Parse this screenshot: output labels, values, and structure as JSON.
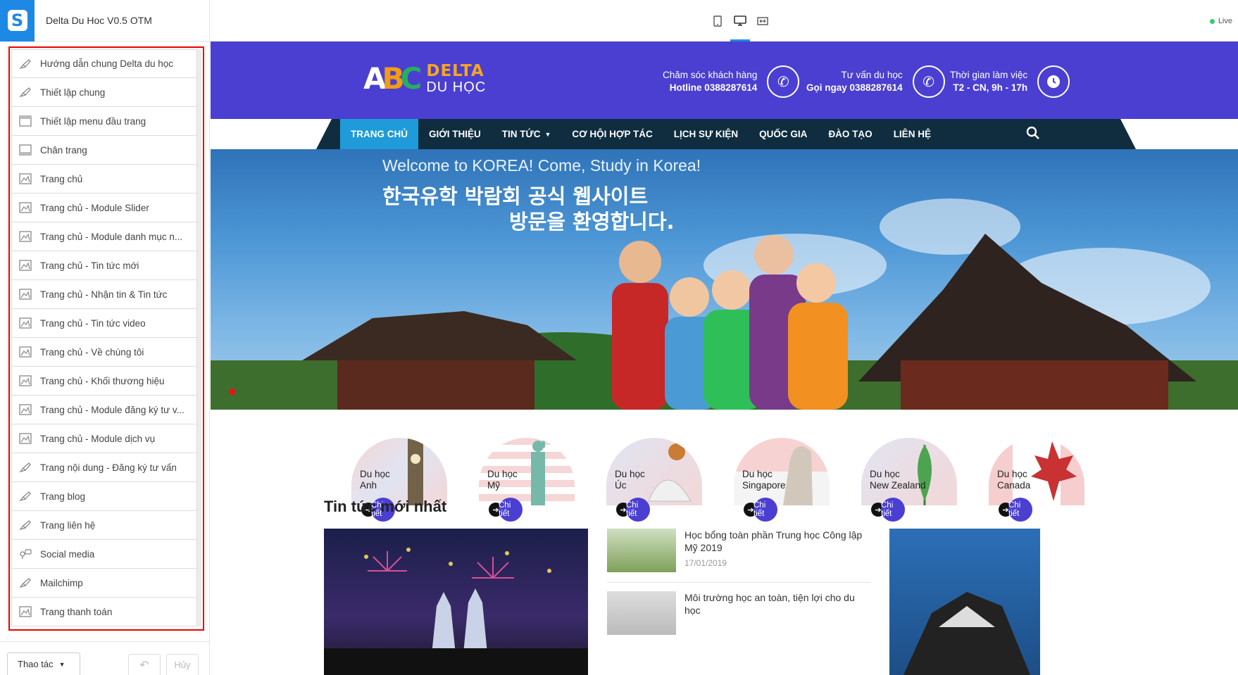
{
  "app": {
    "title": "Delta Du Hoc V0.5 OTM",
    "logo_letter": "S"
  },
  "sidebar": {
    "items": [
      {
        "label": "Hướng dẫn chung Delta du học",
        "icon": "brush-icon"
      },
      {
        "label": "Thiết lập chung",
        "icon": "brush-icon"
      },
      {
        "label": "Thiết lập menu đầu trang",
        "icon": "header-layout-icon"
      },
      {
        "label": "Chân trang",
        "icon": "footer-layout-icon"
      },
      {
        "label": "Trang chủ",
        "icon": "homepage-icon"
      },
      {
        "label": "Trang chủ - Module Slider",
        "icon": "homepage-icon"
      },
      {
        "label": "Trang chủ - Module danh mục n...",
        "icon": "homepage-icon"
      },
      {
        "label": "Trang chủ - Tin tức mới",
        "icon": "homepage-icon"
      },
      {
        "label": "Trang chủ - Nhận tin & Tin tức",
        "icon": "homepage-icon"
      },
      {
        "label": "Trang chủ - Tin tức video",
        "icon": "homepage-icon"
      },
      {
        "label": "Trang chủ - Về chúng tôi",
        "icon": "homepage-icon"
      },
      {
        "label": "Trang chủ - Khối thương hiệu",
        "icon": "homepage-icon"
      },
      {
        "label": "Trang chủ - Module đăng ký tư v...",
        "icon": "homepage-icon"
      },
      {
        "label": "Trang chủ - Module dịch vụ",
        "icon": "homepage-icon"
      },
      {
        "label": "Trang nội dung - Đăng ký tư vấn",
        "icon": "brush-icon"
      },
      {
        "label": "Trang blog",
        "icon": "brush-icon"
      },
      {
        "label": "Trang liên hệ",
        "icon": "brush-icon"
      },
      {
        "label": "Social media",
        "icon": "social-icon"
      },
      {
        "label": "Mailchimp",
        "icon": "brush-icon"
      },
      {
        "label": "Trang thanh toán",
        "icon": "homepage-icon"
      }
    ],
    "footer": {
      "action_label": "Thao tác",
      "cancel_label": "Hủy"
    }
  },
  "topbar": {
    "live_label": "Live"
  },
  "site": {
    "brand": {
      "abc": "ABC",
      "line1": "DELTA",
      "line2": "DU HỌC"
    },
    "header_info": [
      {
        "title": "Chăm sóc khách hàng",
        "value": "Hotline 0388287614",
        "icon": "phone-icon"
      },
      {
        "title": "Tư vấn du học",
        "value": "Gọi ngay 0388287614",
        "icon": "phone-icon"
      },
      {
        "title": "Thời gian làm việc",
        "value": "T2 - CN, 9h - 17h",
        "icon": "clock-icon"
      }
    ],
    "nav": [
      "Trang chủ",
      "Giới thiệu",
      "Tin tức",
      "Cơ hội hợp tác",
      "Lịch sự kiện",
      "Quốc gia",
      "Đào tạo",
      "Liên hệ"
    ],
    "hero": {
      "line1": "Welcome to KOREA! Come, Study in Korea!",
      "line2": "한국유학 박람회 공식 웹사이트",
      "line3": "방문을 환영합니다."
    },
    "destinations": [
      {
        "line1": "Du học",
        "line2": "Anh",
        "more": "Chi tiết"
      },
      {
        "line1": "Du học",
        "line2": "Mỹ",
        "more": "Chi tiết"
      },
      {
        "line1": "Du học",
        "line2": "Úc",
        "more": "Chi tiết"
      },
      {
        "line1": "Du học",
        "line2": "Singapore",
        "more": "Chi tiết"
      },
      {
        "line1": "Du học",
        "line2": "New Zealand",
        "more": "Chi tiết"
      },
      {
        "line1": "Du học",
        "line2": "Canada",
        "more": "Chi tiết"
      }
    ],
    "news": {
      "title": "Tin tức mới nhất",
      "items": [
        {
          "title": "Học bổng toàn phần Trung học Công lập Mỹ 2019",
          "date": "17/01/2019"
        },
        {
          "title": "Môi trường học an toàn, tiện lợi cho du học",
          "date": ""
        }
      ]
    }
  }
}
